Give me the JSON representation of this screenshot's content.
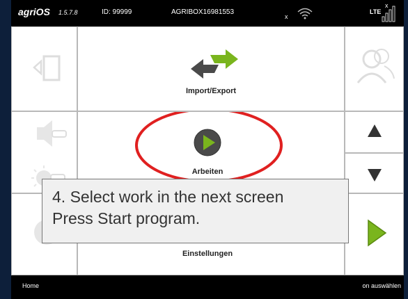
{
  "topbar": {
    "brand": "agriOS",
    "version": "1.5.7.8",
    "device_id": "ID: 99999",
    "box_id": "AGRIBOX16981553",
    "network": "LTE",
    "wifi_status_mark": "x",
    "signal_status_mark": "x"
  },
  "menu": {
    "import_export_label": "Import/Export",
    "work_label": "Arbeiten",
    "settings_label": "Einstellungen"
  },
  "bottombar": {
    "left_label": "Home",
    "right_label": "on auswählen"
  },
  "tooltip": {
    "line1": "4. Select work in the next screen",
    "line2": "Press Start program."
  },
  "colors": {
    "accent_green": "#7ab51d",
    "dark_icon": "#4a4a4a",
    "highlight_red": "#e02020"
  }
}
